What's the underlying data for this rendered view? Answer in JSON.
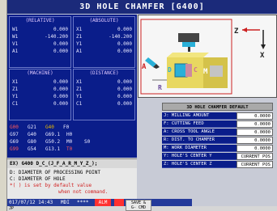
{
  "title": "3D HOLE CHAMFER [G400]",
  "coords": {
    "relative": {
      "header": "(RELATIVE)",
      "rows": [
        [
          "W1",
          "0.000"
        ],
        [
          "W1",
          "-140.200"
        ],
        [
          "V1",
          "0.000"
        ],
        [
          "A1",
          "0.000"
        ]
      ]
    },
    "absolute": {
      "header": "(ABSOLUTE)",
      "rows": [
        [
          "X1",
          "0.000"
        ],
        [
          "Z1",
          "-140.200"
        ],
        [
          "Y1",
          "0.000"
        ],
        [
          "A1",
          "0.000"
        ]
      ]
    },
    "machine": {
      "header": "(MACHINE)",
      "rows": [
        [
          "X1",
          "0.000"
        ],
        [
          "Z1",
          "0.000"
        ],
        [
          "Y1",
          "0.000"
        ],
        [
          "C1",
          "0.000"
        ]
      ]
    },
    "distance": {
      "header": "(DISTANCE)",
      "rows": [
        [
          "X1",
          "0.000"
        ],
        [
          "Z1",
          "0.000"
        ],
        [
          "Y1",
          "0.000"
        ],
        [
          "C1",
          "0.000"
        ]
      ]
    }
  },
  "gcodes": {
    "rows": [
      [
        {
          "t": "G00",
          "c": "#ff5a5a"
        },
        {
          "t": "G21",
          "c": "#e8e8ff"
        },
        {
          "t": "G40",
          "c": "#e8b800"
        },
        {
          "t": "F0",
          "c": "#e8e8ff"
        }
      ],
      [
        {
          "t": "G97",
          "c": "#e8e8ff"
        },
        {
          "t": "G40",
          "c": "#e8e8ff"
        },
        {
          "t": "G69.1",
          "c": "#e8e8ff"
        },
        {
          "t": "H0",
          "c": "#e8e8ff"
        }
      ],
      [
        {
          "t": "G69",
          "c": "#e8e8ff"
        },
        {
          "t": "G80",
          "c": "#e8e8ff"
        },
        {
          "t": "G50.2",
          "c": "#e8e8ff"
        },
        {
          "t": "M0",
          "c": "#e8e8ff"
        },
        {
          "t": "S0",
          "c": "#e8e8ff"
        }
      ],
      [
        {
          "t": "G99",
          "c": "#ff5a5a"
        },
        {
          "t": "G54",
          "c": "#e8e8ff"
        },
        {
          "t": "G13.1",
          "c": "#e8e8ff"
        },
        {
          "t": "T0",
          "c": "#ff5a5a"
        }
      ]
    ]
  },
  "command_line": "EX) G400 D_C_(J_F_A_R_M_Y_Z_);",
  "help": {
    "line1": "D: DIAMETER OF PROCESSING POINT",
    "line2": "C: DIAMETER OF HOLE",
    "line3": "*( ) is set by default value",
    "line4": "when not command."
  },
  "status": {
    "datetime": "017/07/12 14:43",
    "mode": "MDI",
    "stars": "****",
    "alm": "ALM"
  },
  "diagram": {
    "labels": {
      "a": "A",
      "d": "D",
      "c": "C",
      "m": "M",
      "r": "R",
      "z": "Z",
      "x": "X"
    }
  },
  "params": {
    "header": "3D HOLE CHAMFER DEFAULT",
    "rows": [
      {
        "label": "J: MILLING AMOUNT",
        "value": "0.0000"
      },
      {
        "label": "F: CUTTING FEED",
        "value": "0.0000"
      },
      {
        "label": "A: CROSS TOOL ANGLE",
        "value": "0.0000"
      },
      {
        "label": "R: DIST. TO CHAMFER",
        "value": "0.0000"
      },
      {
        "label": "M: WORK DIAMETER",
        "value": "0.0000"
      },
      {
        "label": "Y: HOLE'S CENTER Y",
        "value": "CURRENT POS"
      },
      {
        "label": "Z: HOLE'S CENTER Z",
        "value": "CURRENT POS"
      }
    ]
  },
  "softkeys": {
    "left_label": "JP",
    "save_label1": "SAVE &",
    "save_label2": "G- CMD"
  },
  "colors": {
    "screen_bg": "#0a1d8a",
    "title_bg": "#1b2a7a",
    "accent_red": "#ff5a5a",
    "accent_yellow": "#e8b800"
  }
}
